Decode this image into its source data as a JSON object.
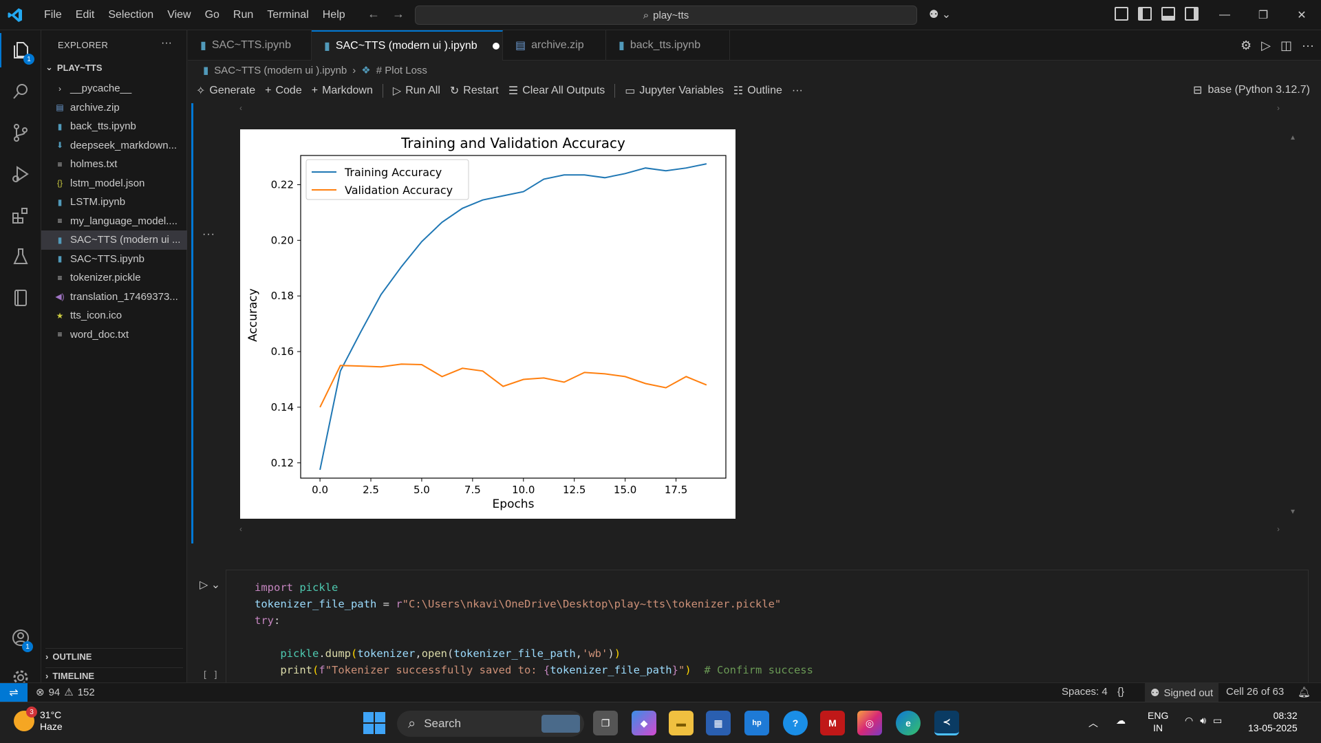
{
  "titlebar": {
    "menu": [
      "File",
      "Edit",
      "Selection",
      "View",
      "Go",
      "Run",
      "Terminal",
      "Help"
    ],
    "search": "play~tts"
  },
  "activity": {
    "explorer_badge": "1",
    "accounts_badge": "1"
  },
  "sidebar": {
    "header": "EXPLORER",
    "folder": "PLAY~TTS",
    "items": [
      {
        "label": "__pycache__",
        "icon": "chevron-right-icon"
      },
      {
        "label": "archive.zip",
        "icon": "zip-file-icon"
      },
      {
        "label": "back_tts.ipynb",
        "icon": "notebook-icon"
      },
      {
        "label": "deepseek_markdown...",
        "icon": "download-file-icon"
      },
      {
        "label": "holmes.txt",
        "icon": "text-file-icon"
      },
      {
        "label": "lstm_model.json",
        "icon": "json-file-icon"
      },
      {
        "label": "LSTM.ipynb",
        "icon": "notebook-icon"
      },
      {
        "label": "my_language_model....",
        "icon": "text-file-icon"
      },
      {
        "label": "SAC~TTS (modern ui ...",
        "icon": "notebook-icon"
      },
      {
        "label": "SAC~TTS.ipynb",
        "icon": "notebook-icon"
      },
      {
        "label": "tokenizer.pickle",
        "icon": "text-file-icon"
      },
      {
        "label": "translation_17469373...",
        "icon": "audio-file-icon"
      },
      {
        "label": "tts_icon.ico",
        "icon": "star-file-icon"
      },
      {
        "label": "word_doc.txt",
        "icon": "text-file-icon"
      }
    ],
    "outline": "OUTLINE",
    "timeline": "TIMELINE"
  },
  "tabs": [
    {
      "label": "SAC~TTS.ipynb"
    },
    {
      "label": "SAC~TTS (modern ui ).ipynb"
    },
    {
      "label": "archive.zip"
    },
    {
      "label": "back_tts.ipynb"
    }
  ],
  "breadcrumb": {
    "file": "SAC~TTS (modern ui ).ipynb",
    "section": "# Plot Loss"
  },
  "toolbar": {
    "generate": "Generate",
    "code": "Code",
    "markdown": "Markdown",
    "run_all": "Run All",
    "restart": "Restart",
    "clear_outputs": "Clear All Outputs",
    "variables": "Jupyter Variables",
    "outline": "Outline",
    "kernel": "base (Python 3.12.7)"
  },
  "colors": {
    "accent": "#0078d4",
    "training_line": "#1f77b4",
    "validation_line": "#ff7f0e"
  },
  "chart_data": {
    "type": "line",
    "title": "Training and Validation Accuracy",
    "xlabel": "Epochs",
    "ylabel": "Accuracy",
    "xlim": [
      -0.95,
      19.95
    ],
    "ylim": [
      0.1145,
      0.2305
    ],
    "xticks": [
      0.0,
      2.5,
      5.0,
      7.5,
      10.0,
      12.5,
      15.0,
      17.5
    ],
    "xtick_labels": [
      "0.0",
      "2.5",
      "5.0",
      "7.5",
      "10.0",
      "12.5",
      "15.0",
      "17.5"
    ],
    "yticks": [
      0.12,
      0.14,
      0.16,
      0.18,
      0.2,
      0.22
    ],
    "ytick_labels": [
      "0.12",
      "0.14",
      "0.16",
      "0.18",
      "0.20",
      "0.22"
    ],
    "legend_position": "top-left",
    "grid": false,
    "x": [
      0,
      1,
      2,
      3,
      4,
      5,
      6,
      7,
      8,
      9,
      10,
      11,
      12,
      13,
      14,
      15,
      16,
      17,
      18,
      19
    ],
    "series": [
      {
        "name": "Training Accuracy",
        "color": "#1f77b4",
        "values": [
          0.1175,
          0.153,
          0.167,
          0.1805,
          0.1905,
          0.1995,
          0.2065,
          0.2115,
          0.2145,
          0.216,
          0.2175,
          0.222,
          0.2235,
          0.2235,
          0.2225,
          0.224,
          0.226,
          0.225,
          0.226,
          0.2275
        ]
      },
      {
        "name": "Validation Accuracy",
        "color": "#ff7f0e",
        "values": [
          0.14,
          0.155,
          0.1548,
          0.1545,
          0.1555,
          0.1553,
          0.151,
          0.154,
          0.153,
          0.1475,
          0.15,
          0.1505,
          0.149,
          0.1525,
          0.152,
          0.151,
          0.1485,
          0.147,
          0.151,
          0.148
        ]
      }
    ]
  },
  "code": {
    "lines": [
      "import pickle",
      "tokenizer_file_path = r\"C:\\Users\\nkavi\\OneDrive\\Desktop\\play~tts\\tokenizer.pickle\"",
      "try:",
      "",
      "    pickle.dump(tokenizer,open(tokenizer_file_path,'wb'))",
      "    print(f\"Tokenizer successfully saved to: {tokenizer_file_path}\")  # Confirm success"
    ],
    "exec_count": "[ ]"
  },
  "statusbar": {
    "errors": "94",
    "warnings": "152",
    "spaces": "Spaces: 4",
    "signed_out": "Signed out",
    "cell": "Cell 26 of 63"
  },
  "taskbar": {
    "weather_temp": "31°C",
    "weather_desc": "Haze",
    "weather_badge": "3",
    "search": "Search",
    "lang_top": "ENG",
    "lang_bottom": "IN",
    "time": "08:32",
    "date": "13-05-2025"
  }
}
